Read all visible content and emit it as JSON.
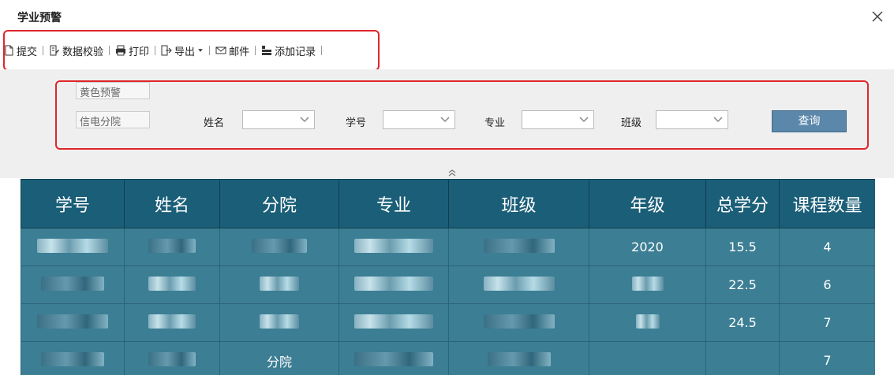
{
  "window": {
    "title": "学业预警"
  },
  "toolbar": {
    "submit_label": "提交",
    "validate_label": "数据校验",
    "print_label": "打印",
    "export_label": "导出",
    "mail_label": "邮件",
    "add_record_label": "添加记录"
  },
  "filter": {
    "warning_level": "黄色预警",
    "college": "信电分院",
    "name_label": "姓名",
    "student_id_label": "学号",
    "major_label": "专业",
    "class_label": "班级",
    "query_label": "查询"
  },
  "table": {
    "columns": [
      "学号",
      "姓名",
      "分院",
      "专业",
      "班级",
      "年级",
      "总学分",
      "课程数量"
    ],
    "rows": [
      {
        "year": "2020",
        "credits": "15.5",
        "courses": "4"
      },
      {
        "year": "",
        "credits": "22.5",
        "courses": "6"
      },
      {
        "year": "",
        "credits": "24.5",
        "courses": "7"
      },
      {
        "college": "分院",
        "year": "",
        "credits": "",
        "courses": "7"
      }
    ]
  },
  "colors": {
    "header_bg": "#1b5e78",
    "row_bg": "#3c7e94",
    "highlight": "#e0262b",
    "query_button": "#5a87aa"
  }
}
